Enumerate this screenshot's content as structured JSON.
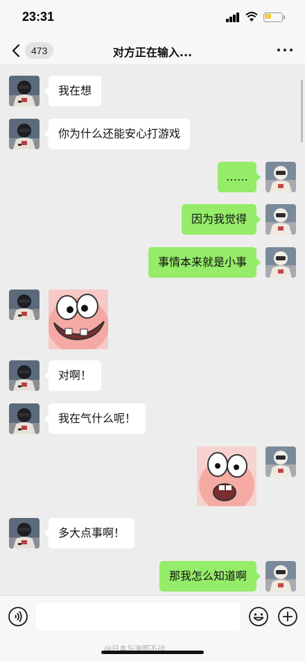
{
  "status_bar": {
    "time": "23:31"
  },
  "nav": {
    "unread_count": "473",
    "title": "对方正在输入..."
  },
  "messages": [
    {
      "side": "left",
      "type": "text",
      "text": "我在想"
    },
    {
      "side": "left",
      "type": "text",
      "text": "你为什么还能安心打游戏"
    },
    {
      "side": "right",
      "type": "text",
      "text": "……"
    },
    {
      "side": "right",
      "type": "text",
      "text": "因为我觉得"
    },
    {
      "side": "right",
      "type": "text",
      "text": "事情本来就是小事"
    },
    {
      "side": "left",
      "type": "sticker",
      "sticker": "patrick-grin-sticker"
    },
    {
      "side": "left",
      "type": "text",
      "text": "对啊！"
    },
    {
      "side": "left",
      "type": "text",
      "text": "我在气什么呢！"
    },
    {
      "side": "right",
      "type": "sticker",
      "sticker": "patrick-shocked-sticker"
    },
    {
      "side": "left",
      "type": "text",
      "text": "多大点事啊！"
    },
    {
      "side": "right",
      "type": "text",
      "text": "那我怎么知道啊"
    }
  ],
  "watermark": "@日本与海那不战",
  "colors": {
    "sent_bubble": "#95ec69",
    "received_bubble": "#ffffff",
    "background": "#ededed"
  },
  "icons": {
    "back": "chevron-left-icon",
    "more": "more-dots-icon",
    "voice": "voice-icon",
    "emoji": "emoji-icon",
    "plus": "plus-icon"
  }
}
